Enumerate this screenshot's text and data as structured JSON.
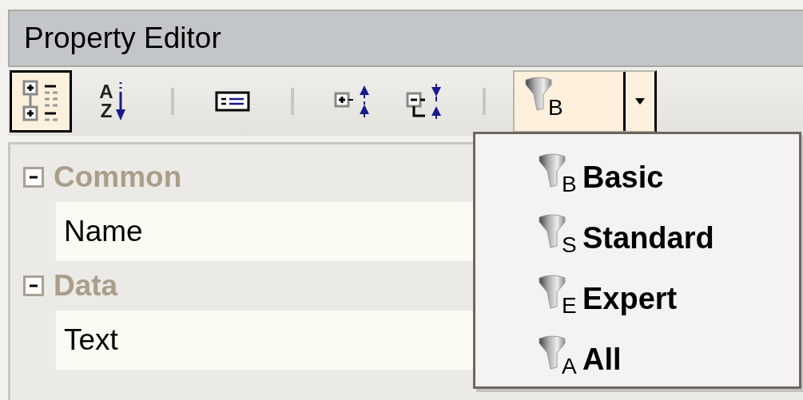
{
  "window": {
    "title": "Property Editor"
  },
  "toolbar": [
    {
      "kind": "categorized",
      "selected": true
    },
    {
      "kind": "alphabetical",
      "selected": false,
      "letters": [
        "A",
        "Z"
      ]
    },
    {
      "kind": "separator"
    },
    {
      "kind": "property-pages",
      "selected": false
    },
    {
      "kind": "separator"
    },
    {
      "kind": "expand-all",
      "selected": false
    },
    {
      "kind": "collapse-all",
      "selected": false
    },
    {
      "kind": "separator"
    },
    {
      "kind": "filter",
      "letter": "B",
      "menu_open": true
    }
  ],
  "categories": [
    {
      "name": "Common",
      "expanded": true,
      "properties": [
        {
          "name": "Name"
        }
      ]
    },
    {
      "name": "Data",
      "expanded": true,
      "properties": [
        {
          "name": "Text"
        }
      ]
    }
  ],
  "filter_menu": [
    {
      "label": "Basic",
      "letter": "B"
    },
    {
      "label": "Standard",
      "letter": "S"
    },
    {
      "label": "Expert",
      "letter": "E"
    },
    {
      "label": "All",
      "letter": "A"
    }
  ]
}
